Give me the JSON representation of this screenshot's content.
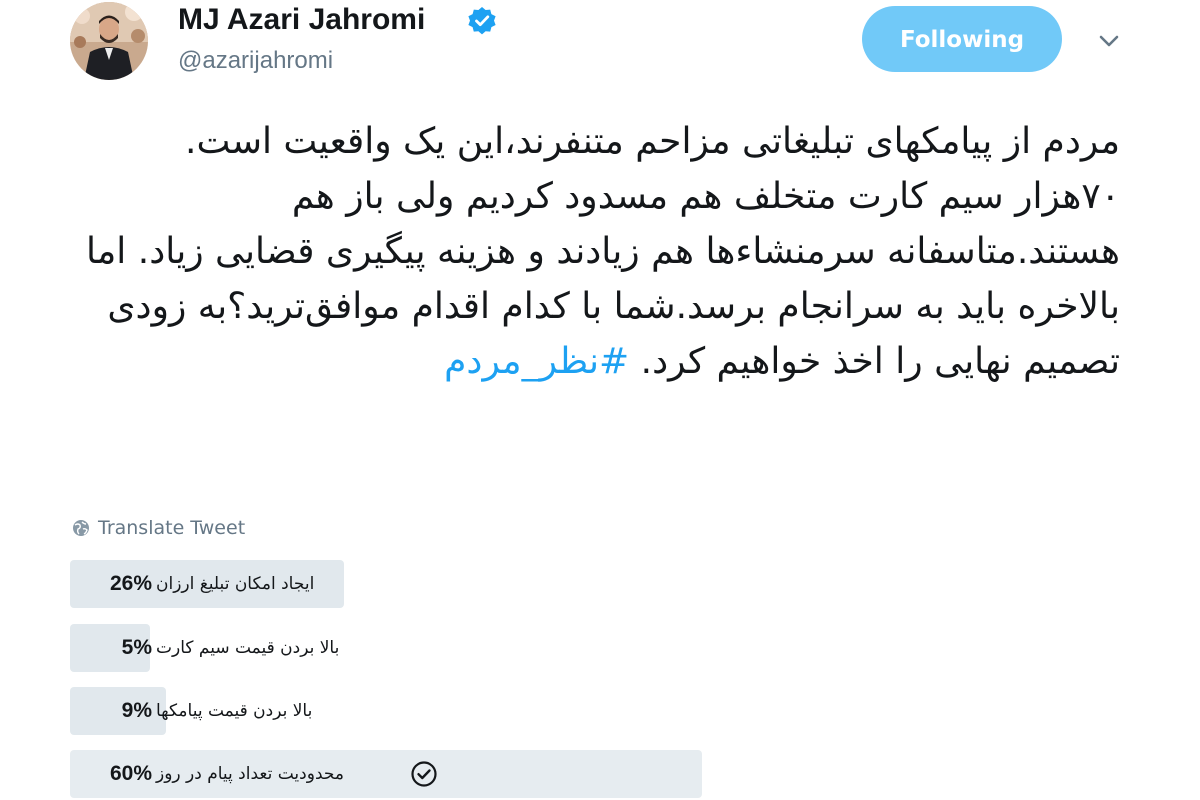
{
  "user": {
    "display_name": "MJ Azari Jahromi",
    "handle": "@azarijahromi",
    "verified": true
  },
  "follow_button": {
    "label": "Following",
    "color": "#71c9f8"
  },
  "tweet": {
    "text": "مردم از پیامکهای تبلیغاتی مزاحم متنفرند،این یک واقعیت است. ۷۰هزار سیم کارت متخلف هم مسدود کردیم ولی باز هم هستند.متاسفانه سرمنشاءها هم زیادند و هزینه پیگیری قضایی زیاد. اما بالاخره باید به سرانجام برسد.شما با کدام اقدام موافق‌ترید؟به زودی تصمیم نهایی را اخذ خواهیم کرد.",
    "hashtag": "#نظر_مردم",
    "hashtag_color": "#1da1f2"
  },
  "translate": {
    "label": "Translate Tweet"
  },
  "poll": {
    "options": [
      {
        "percent_label": "26%",
        "percent": 26,
        "label": "ایجاد امکان تبلیغ ارزان",
        "winner": false
      },
      {
        "percent_label": "5%",
        "percent": 5,
        "label": "بالا بردن قیمت سیم کارت",
        "winner": false
      },
      {
        "percent_label": "9%",
        "percent": 9,
        "label": "بالا بردن قیمت پیامکها",
        "winner": false
      },
      {
        "percent_label": "60%",
        "percent": 60,
        "label": "محدودیت تعداد پیام در روز",
        "winner": true
      }
    ]
  }
}
